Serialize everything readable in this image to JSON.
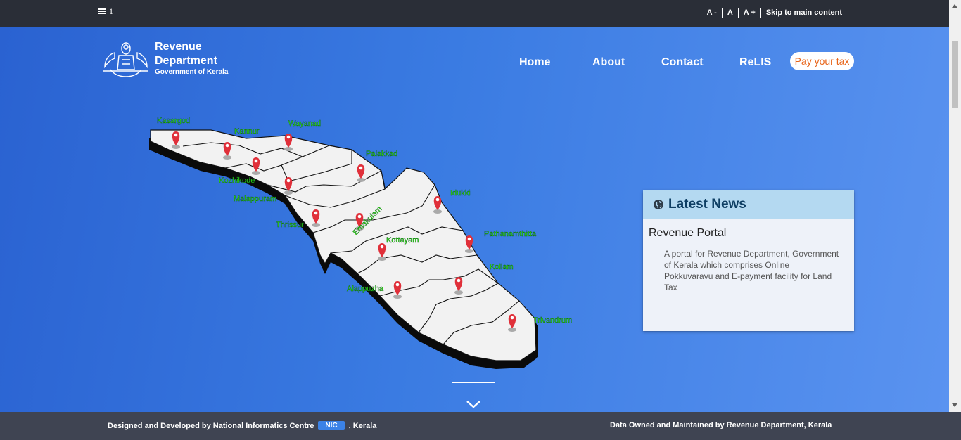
{
  "topbar": {
    "counter": "1",
    "font_decrease": "A -",
    "font_normal": "A",
    "font_increase": "A +",
    "skip_link": "Skip to main content"
  },
  "header": {
    "brand_line1": "Revenue",
    "brand_line2": "Department",
    "brand_line3": "Government of Kerala",
    "nav": [
      "Home",
      "About",
      "Contact",
      "ReLIS"
    ],
    "pay_button": "Pay your tax"
  },
  "map": {
    "districts": [
      "Kasargod",
      "Kannur",
      "Wayanad",
      "Kozhikode",
      "Palakkad",
      "Malappuram",
      "Thrissur",
      "Ernakulam",
      "Idukki",
      "Kottayam",
      "Pathanamthitta",
      "Kollam",
      "Alappuzha",
      "Trivandrum"
    ]
  },
  "news": {
    "heading": "Latest News",
    "item_title": "Revenue Portal",
    "item_desc": "A portal for Revenue Department, Government of Kerala which comprises Online Pokkuvaravu and E-payment facility for Land Tax"
  },
  "footer": {
    "left_text": "Designed and Developed by National Informatics Centre",
    "nic_badge": "NIC",
    "left_suffix": ", Kerala",
    "right_text": "Data Owned and Maintained by Revenue Department, Kerala"
  },
  "colors": {
    "topbar": "#2a2e37",
    "footer": "#3f4452",
    "accent_pay": "#e8651a",
    "news_head": "#b4d9f1",
    "district_label": "#39ff14",
    "pin": "#e0303a"
  }
}
